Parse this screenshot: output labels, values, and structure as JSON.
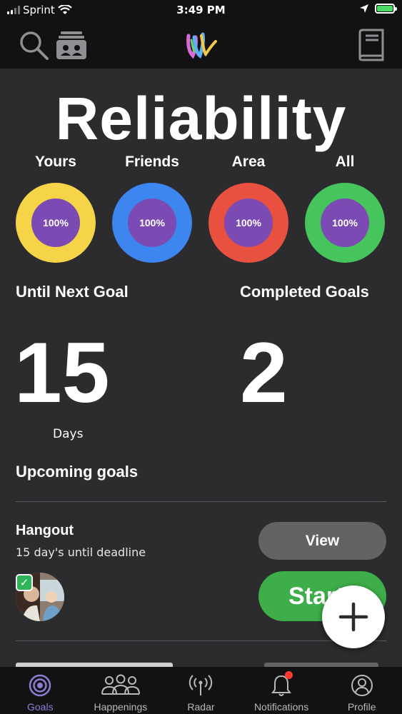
{
  "status_bar": {
    "carrier": "Sprint",
    "time": "3:49 PM"
  },
  "header": {
    "left_icons": [
      "search-icon",
      "id-cards-icon"
    ],
    "logo": "app-logo",
    "right_icon": "book-icon"
  },
  "title": "Reliability",
  "rings": [
    {
      "label": "Yours",
      "value": "100%",
      "color": "#f5d547"
    },
    {
      "label": "Friends",
      "value": "100%",
      "color": "#3d86f0"
    },
    {
      "label": "Area",
      "value": "100%",
      "color": "#e8503f"
    },
    {
      "label": "All",
      "value": "100%",
      "color": "#45c55c"
    }
  ],
  "stats": {
    "until_next_label": "Until Next Goal",
    "until_next_value": "15",
    "until_next_unit": "Days",
    "completed_label": "Completed Goals",
    "completed_value": "2"
  },
  "upcoming_title": "Upcoming goals",
  "goals": [
    {
      "title": "Hangout",
      "subtitle": "15 day's until deadline",
      "view_label": "View",
      "start_label": "Start"
    }
  ],
  "tabs": [
    {
      "label": "Goals",
      "icon": "target-icon",
      "active": true
    },
    {
      "label": "Happenings",
      "icon": "people-icon"
    },
    {
      "label": "Radar",
      "icon": "radar-icon"
    },
    {
      "label": "Notifications",
      "icon": "bell-icon"
    },
    {
      "label": "Profile",
      "icon": "profile-icon"
    }
  ],
  "colors": {
    "background": "#2c2c2e",
    "bar": "#121212",
    "accent": "#8f7bd8",
    "ring_center": "#7b4bb3",
    "start_button": "#3dae49",
    "view_button": "#636366"
  }
}
